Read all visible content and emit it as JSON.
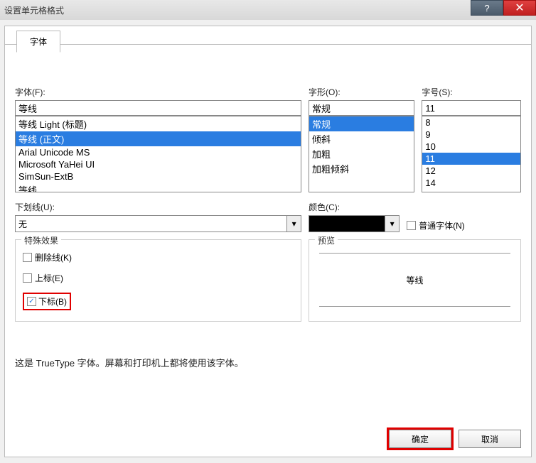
{
  "window": {
    "title": "设置单元格格式"
  },
  "tab": {
    "label": "字体"
  },
  "font": {
    "label": "字体(F):",
    "value": "等线",
    "options": [
      "等线 Light (标题)",
      "等线 (正文)",
      "Arial Unicode MS",
      "Microsoft YaHei UI",
      "SimSun-ExtB",
      "等线"
    ],
    "selected_index": 1
  },
  "style": {
    "label": "字形(O):",
    "value": "常规",
    "options": [
      "常规",
      "倾斜",
      "加粗",
      "加粗倾斜"
    ],
    "selected_index": 0
  },
  "size": {
    "label": "字号(S):",
    "value": "11",
    "options": [
      "8",
      "9",
      "10",
      "11",
      "12",
      "14"
    ],
    "selected_index": 3
  },
  "underline": {
    "label": "下划线(U):",
    "value": "无"
  },
  "color": {
    "label": "颜色(C):"
  },
  "normal_font": {
    "label": "普通字体(N)",
    "checked": false
  },
  "effects": {
    "legend": "特殊效果",
    "strikethrough": {
      "label": "删除线(K)",
      "checked": false
    },
    "superscript": {
      "label": "上标(E)",
      "checked": false
    },
    "subscript": {
      "label": "下标(B)",
      "checked": true
    }
  },
  "preview": {
    "legend": "预览",
    "text": "等线"
  },
  "note": "这是 TrueType 字体。屏幕和打印机上都将使用该字体。",
  "buttons": {
    "ok": "确定",
    "cancel": "取消"
  }
}
